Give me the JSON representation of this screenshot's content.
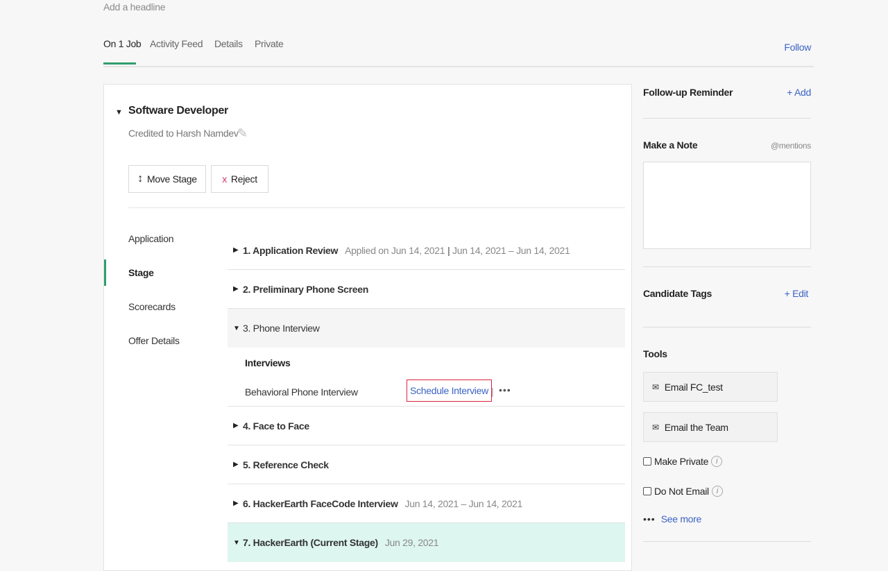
{
  "header": {
    "headline_placeholder": "Add a headline",
    "follow_label": "Follow"
  },
  "tabs": [
    {
      "label": "On 1 Job"
    },
    {
      "label": "Activity Feed"
    },
    {
      "label": "Details"
    },
    {
      "label": "Private"
    }
  ],
  "job": {
    "title": "Software Developer",
    "credited": "Credited to Harsh Namdev",
    "move_stage_label": "Move Stage",
    "reject_label": "Reject"
  },
  "side_nav": [
    {
      "label": "Application"
    },
    {
      "label": "Stage"
    },
    {
      "label": "Scorecards"
    },
    {
      "label": "Offer Details"
    }
  ],
  "stages": [
    {
      "name": "1. Application Review",
      "meta": "Applied on Jun 14, 2021",
      "meta_sep": "|",
      "meta2": "Jun 14, 2021 – Jun 14, 2021"
    },
    {
      "name": "2. Preliminary Phone Screen"
    },
    {
      "name": "3. Phone Interview"
    },
    {
      "name": "4. Face to Face"
    },
    {
      "name": "5. Reference Check"
    },
    {
      "name": "6. HackerEarth FaceCode Interview",
      "meta": "Jun 14, 2021 – Jun 14, 2021"
    },
    {
      "name": "7. HackerEarth (Current Stage)",
      "meta": "Jun 29, 2021"
    }
  ],
  "interviews": {
    "title": "Interviews",
    "item_name": "Behavioral Phone Interview",
    "schedule_label": "Schedule Interview",
    "sep": "|",
    "more": "•••"
  },
  "right": {
    "followup_title": "Follow-up Reminder",
    "followup_add": "+ Add",
    "note_title": "Make a Note",
    "note_hint": "@mentions",
    "tags_title": "Candidate Tags",
    "tags_edit": "+ Edit",
    "tools_title": "Tools",
    "email_candidate": "Email FC_test",
    "email_team": "Email the Team",
    "make_private": "Make Private",
    "do_not_email": "Do Not Email",
    "info_glyph": "i",
    "see_more": "See more",
    "see_more_dots": "•••"
  },
  "colors": {
    "accent_green": "#2e9e6e",
    "link_blue": "#3b63c4",
    "current_stage_bg": "#ddf6ef",
    "highlight_red": "#d9233a"
  }
}
